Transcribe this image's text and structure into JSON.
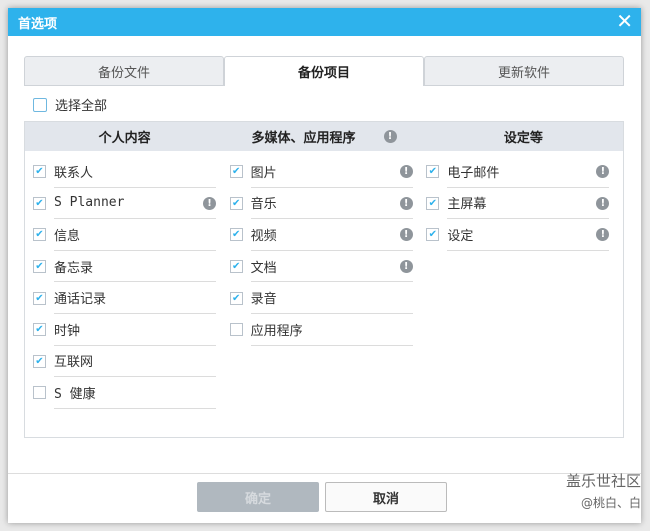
{
  "title": "首选项",
  "tabs": [
    {
      "label": "备份文件",
      "active": false
    },
    {
      "label": "备份项目",
      "active": true
    },
    {
      "label": "更新软件",
      "active": false
    }
  ],
  "select_all": {
    "label": "选择全部",
    "checked": false
  },
  "columns": [
    {
      "header": "个人内容",
      "info": false,
      "items": [
        {
          "label": "联系人",
          "checked": true,
          "info": false
        },
        {
          "label": "S Planner",
          "checked": true,
          "info": true
        },
        {
          "label": "信息",
          "checked": true,
          "info": false
        },
        {
          "label": "备忘录",
          "checked": true,
          "info": false
        },
        {
          "label": "通话记录",
          "checked": true,
          "info": false
        },
        {
          "label": "时钟",
          "checked": true,
          "info": false
        },
        {
          "label": "互联网",
          "checked": true,
          "info": false
        },
        {
          "label": "S 健康",
          "checked": false,
          "info": false
        }
      ]
    },
    {
      "header": "多媒体、应用程序",
      "info": true,
      "items": [
        {
          "label": "图片",
          "checked": true,
          "info": true
        },
        {
          "label": "音乐",
          "checked": true,
          "info": true
        },
        {
          "label": "视频",
          "checked": true,
          "info": true
        },
        {
          "label": "文档",
          "checked": true,
          "info": true
        },
        {
          "label": "录音",
          "checked": true,
          "info": false
        },
        {
          "label": "应用程序",
          "checked": false,
          "info": false
        }
      ]
    },
    {
      "header": "设定等",
      "info": false,
      "items": [
        {
          "label": "电子邮件",
          "checked": true,
          "info": true
        },
        {
          "label": "主屏幕",
          "checked": true,
          "info": true
        },
        {
          "label": "设定",
          "checked": true,
          "info": true
        }
      ]
    }
  ],
  "buttons": {
    "ok": "确定",
    "cancel": "取消"
  },
  "watermark": {
    "line1": "盖乐世社区",
    "line2": "@桃白、白"
  },
  "colors": {
    "accent": "#2eb2ec"
  }
}
